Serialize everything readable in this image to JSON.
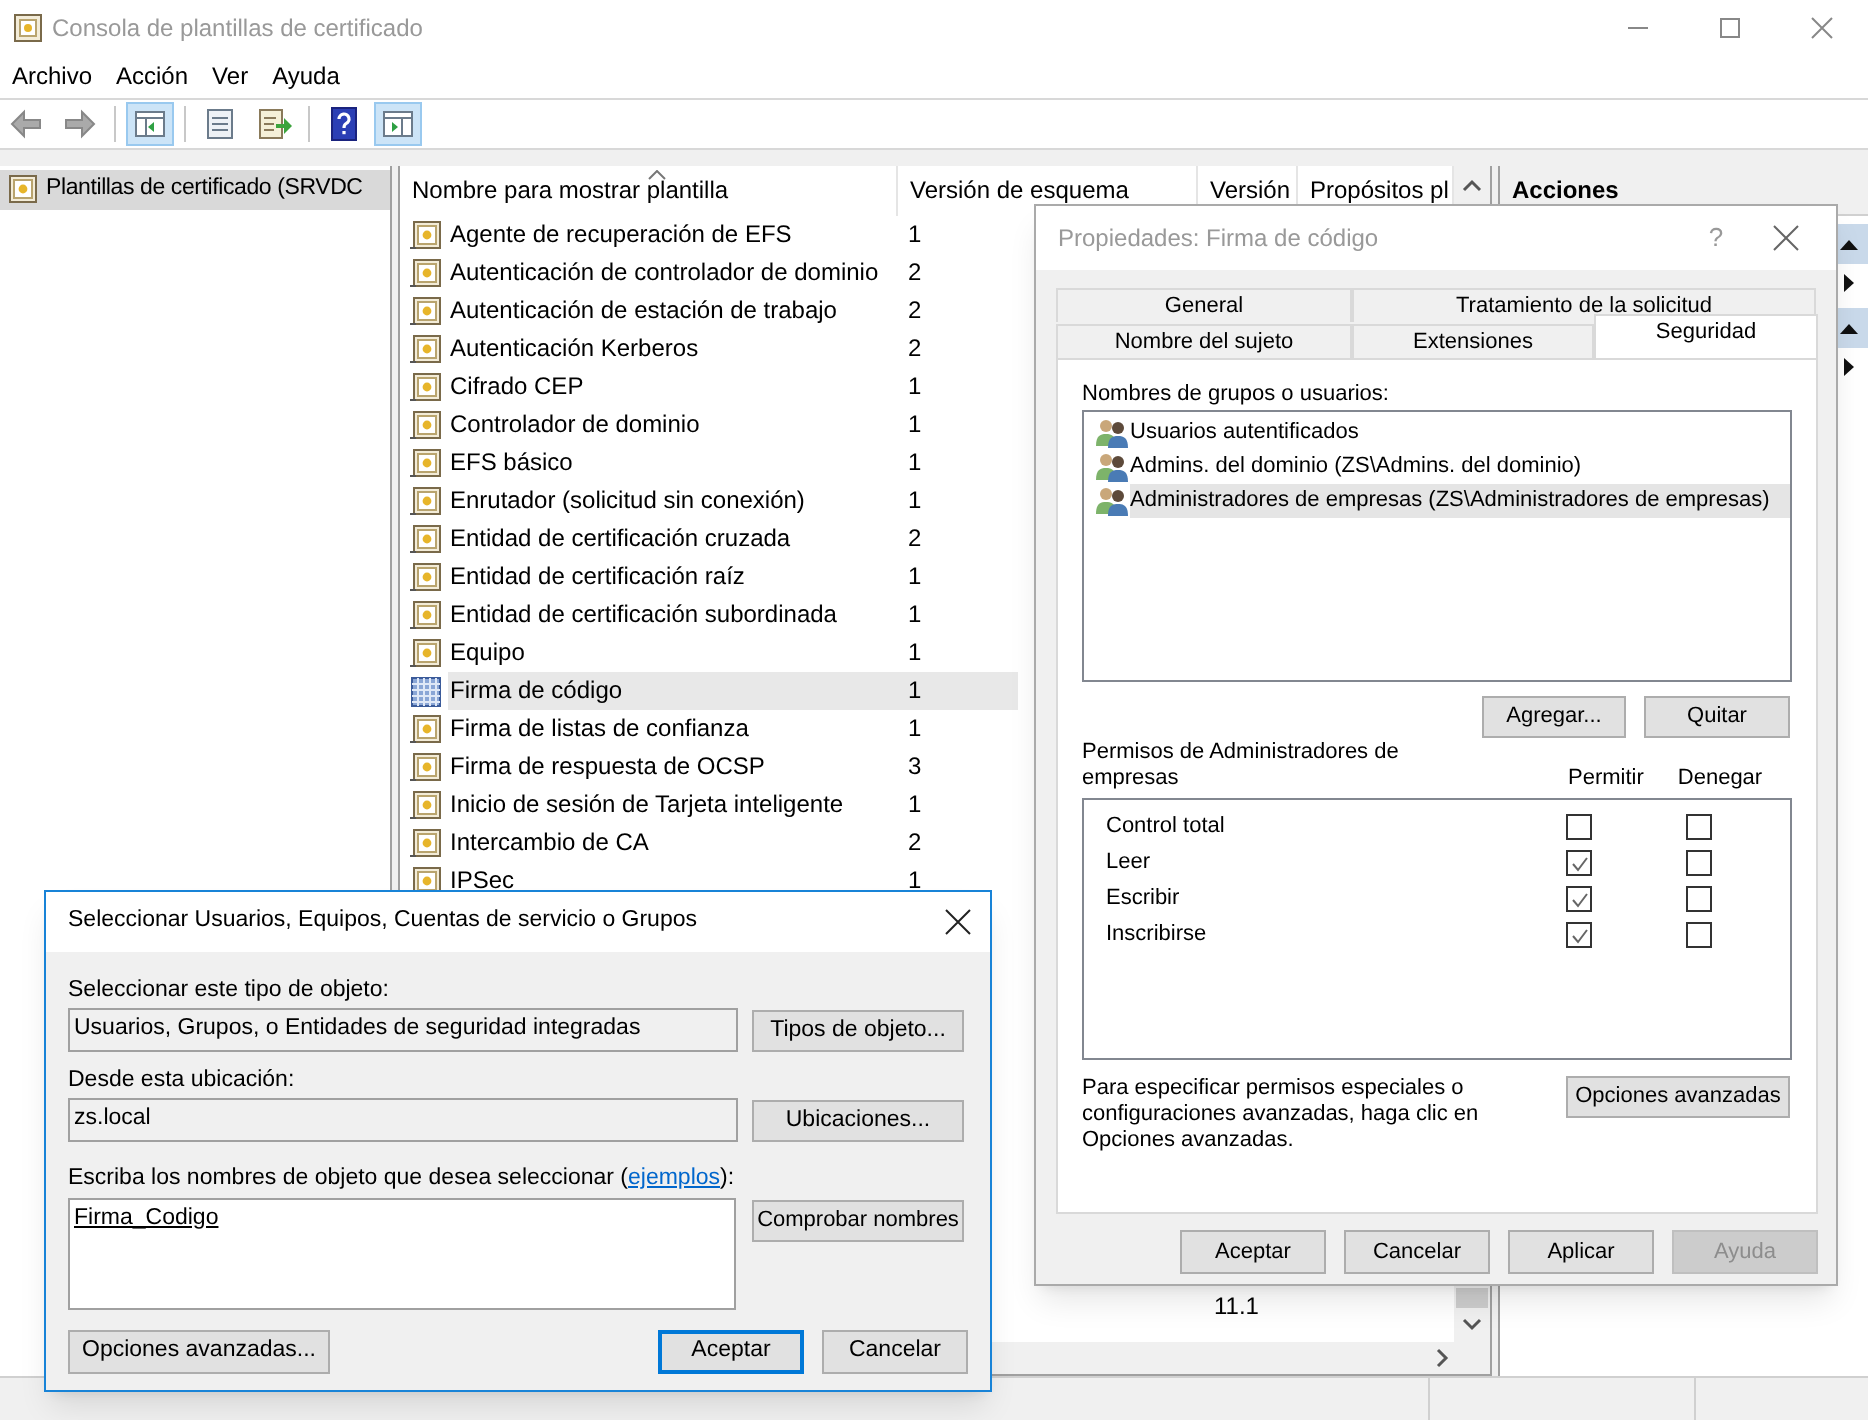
{
  "window": {
    "title": "Consola de plantillas de certificado"
  },
  "menu": [
    "Archivo",
    "Acción",
    "Ver",
    "Ayuda"
  ],
  "toolbar": [
    [
      {
        "kind": "back",
        "pressed": false
      },
      {
        "kind": "forward",
        "pressed": false
      }
    ],
    [
      {
        "kind": "tree_pane",
        "pressed": true
      }
    ],
    [
      {
        "kind": "properties",
        "pressed": false
      },
      {
        "kind": "export",
        "pressed": false
      }
    ],
    [
      {
        "kind": "help",
        "pressed": false
      },
      {
        "kind": "action_pane",
        "pressed": true
      }
    ]
  ],
  "tree": {
    "items": [
      {
        "label": "Plantillas de certificado (SRVDC",
        "selected": true
      }
    ]
  },
  "list": {
    "columns": [
      "Nombre para mostrar plantilla",
      "Versión de esquema",
      "Versión",
      "Propósitos pl"
    ],
    "rows": [
      {
        "name": "Agente de recuperación de EFS",
        "schema_version": "1",
        "selected": false
      },
      {
        "name": "Autenticación de controlador de dominio",
        "schema_version": "2",
        "selected": false
      },
      {
        "name": "Autenticación de estación de trabajo",
        "schema_version": "2",
        "selected": false
      },
      {
        "name": "Autenticación Kerberos",
        "schema_version": "2",
        "selected": false
      },
      {
        "name": "Cifrado CEP",
        "schema_version": "1",
        "selected": false
      },
      {
        "name": "Controlador de dominio",
        "schema_version": "1",
        "selected": false
      },
      {
        "name": "EFS básico",
        "schema_version": "1",
        "selected": false
      },
      {
        "name": "Enrutador (solicitud sin conexión)",
        "schema_version": "1",
        "selected": false
      },
      {
        "name": "Entidad de certificación cruzada",
        "schema_version": "2",
        "selected": false
      },
      {
        "name": "Entidad de certificación raíz",
        "schema_version": "1",
        "selected": false
      },
      {
        "name": "Entidad de certificación subordinada",
        "schema_version": "1",
        "selected": false
      },
      {
        "name": "Equipo",
        "schema_version": "1",
        "selected": false
      },
      {
        "name": "Firma de código",
        "schema_version": "1",
        "selected": true
      },
      {
        "name": "Firma de listas de confianza",
        "schema_version": "1",
        "selected": false
      },
      {
        "name": "Firma de respuesta de OCSP",
        "schema_version": "3",
        "selected": false
      },
      {
        "name": "Inicio de sesión de Tarjeta inteligente",
        "schema_version": "1",
        "selected": false
      },
      {
        "name": "Intercambio de CA",
        "schema_version": "2",
        "selected": false
      },
      {
        "name": "IPSec",
        "schema_version": "1",
        "selected": false
      }
    ],
    "partial_row": {
      "version": "11.1"
    }
  },
  "actions": {
    "title": "Acciones"
  },
  "properties_dialog": {
    "title": "Propiedades: Firma de código",
    "help_glyph": "?",
    "tab_rows": [
      [
        {
          "label": "General",
          "selected": false
        },
        {
          "label": "Tratamiento de la solicitud",
          "selected": false
        }
      ],
      [
        {
          "label": "Nombre del sujeto",
          "selected": false
        },
        {
          "label": "Extensiones",
          "selected": false
        },
        {
          "label": "Seguridad",
          "selected": true
        }
      ]
    ],
    "groups_label": "Nombres de grupos o usuarios:",
    "groups": [
      {
        "name": "Usuarios autentificados",
        "selected": false
      },
      {
        "name": "Admins. del dominio (ZS\\Admins. del dominio)",
        "selected": false
      },
      {
        "name": "Administradores de empresas (ZS\\Administradores de empresas)",
        "selected": true
      }
    ],
    "add_button": "Agregar...",
    "remove_button": "Quitar",
    "permissions_label": "Permisos de Administradores de empresas",
    "allow_header": "Permitir",
    "deny_header": "Denegar",
    "permissions": [
      {
        "name": "Control total",
        "allow": false,
        "deny": false
      },
      {
        "name": "Leer",
        "allow": true,
        "deny": false
      },
      {
        "name": "Escribir",
        "allow": true,
        "deny": false
      },
      {
        "name": "Inscribirse",
        "allow": true,
        "deny": false
      }
    ],
    "advanced_text": "Para especificar permisos especiales o configuraciones avanzadas, haga clic en Opciones avanzadas.",
    "advanced_button": "Opciones avanzadas",
    "buttons": [
      {
        "label": "Aceptar",
        "disabled": false
      },
      {
        "label": "Cancelar",
        "disabled": false
      },
      {
        "label": "Aplicar",
        "disabled": false
      },
      {
        "label": "Ayuda",
        "disabled": true
      }
    ]
  },
  "select_dialog": {
    "title": "Seleccionar Usuarios, Equipos, Cuentas de servicio o Grupos",
    "type_label": "Seleccionar este tipo de objeto:",
    "type_value": "Usuarios, Grupos, o Entidades de seguridad integradas",
    "type_button": "Tipos de objeto...",
    "location_label": "Desde esta ubicación:",
    "location_value": "zs.local",
    "location_button": "Ubicaciones...",
    "names_label_before": "Escriba los nombres de objeto que desea seleccionar (",
    "names_link": "ejemplos",
    "names_label_after": "):",
    "names_value": "Firma_Codigo",
    "check_button": "Comprobar nombres",
    "advanced_button": "Opciones avanzadas...",
    "buttons": [
      {
        "label": "Aceptar",
        "default": true
      },
      {
        "label": "Cancelar",
        "default": false
      }
    ]
  }
}
